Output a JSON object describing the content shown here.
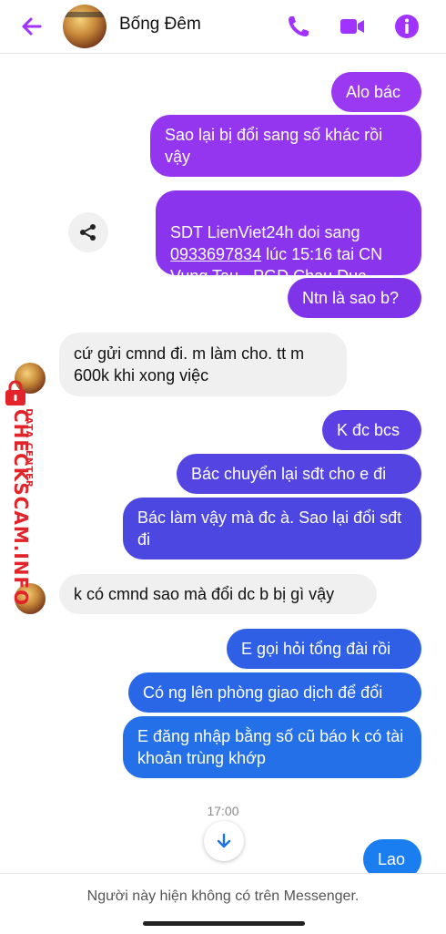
{
  "header": {
    "contact_name": "Bống Đêm",
    "icons": [
      "arrow-left-icon",
      "phone-icon",
      "video-camera-icon",
      "info-icon"
    ],
    "accent_color": "#a033ff"
  },
  "messages": [
    {
      "sender": "me",
      "text": "Alo bác"
    },
    {
      "sender": "me",
      "text": "Sao lại bị đổi sang số khác rồi vậy"
    },
    {
      "sender": "me",
      "text_before": "SDT LienViet24h doi sang ",
      "link": "0933697834",
      "text_after": " lúc 15:16 tai CN Vung Tau - PGD Chau Duc"
    },
    {
      "sender": "me",
      "text": "Ntn là sao b?"
    },
    {
      "sender": "them",
      "text": "cứ gửi cmnd đi. m làm cho. tt m 600k khi xong việc"
    },
    {
      "sender": "me",
      "text": "K đc bcs"
    },
    {
      "sender": "me",
      "text": "Bác chuyển lại sđt cho e đi"
    },
    {
      "sender": "me",
      "text": "Bác làm vậy mà đc à. Sao lại đổi sđt đi"
    },
    {
      "sender": "them",
      "text": "k có cmnd sao mà đổi dc b bị gì vậy"
    },
    {
      "sender": "me",
      "text": "E gọi hỏi tổng đài rồi"
    },
    {
      "sender": "me",
      "text": "Có ng lên phòng giao dịch để đổi"
    },
    {
      "sender": "me",
      "text": "E đăng nhập bằng số cũ báo k có tài khoản trùng khớp"
    },
    {
      "sender": "me",
      "text": "Lao"
    }
  ],
  "timestamp": "17:00",
  "watermark": {
    "brand": "CHECKSCAM.INFO",
    "tagline": "DATA CENTER",
    "color": "#e2232a"
  },
  "footer": {
    "text": "Người này hiện không có trên Messenger."
  }
}
